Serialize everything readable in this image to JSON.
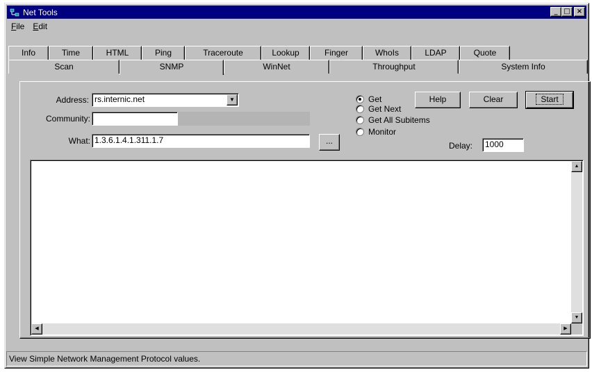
{
  "window": {
    "title": "Net Tools",
    "title_icon": "network-icon",
    "controls": [
      "minimize",
      "maximize",
      "close"
    ]
  },
  "menu": [
    {
      "label": "File",
      "accel": "F",
      "rest": "ile"
    },
    {
      "label": "Edit",
      "accel": "E",
      "rest": "dit"
    }
  ],
  "tabs": {
    "row1": [
      "Info",
      "Time",
      "HTML",
      "Ping",
      "Traceroute",
      "Lookup",
      "Finger",
      "WhoIs",
      "LDAP",
      "Quote"
    ],
    "row2": [
      "Scan",
      "SNMP",
      "WinNet",
      "Throughput",
      "System Info"
    ],
    "active": "SNMP"
  },
  "form": {
    "address_label": "Address:",
    "address_value": "rs.internic.net",
    "community_label": "Community:",
    "community_value": "",
    "what_label": "What:",
    "what_value": "1.3.6.1.4.1.311.1.7",
    "browse_label": "...",
    "delay_label": "Delay:",
    "delay_value": "1000"
  },
  "radios": [
    {
      "label": "Get",
      "checked": true
    },
    {
      "label": "Get Next",
      "checked": false
    },
    {
      "label": "Get All Subitems",
      "checked": false
    },
    {
      "label": "Monitor",
      "checked": false
    }
  ],
  "buttons": {
    "help": "Help",
    "clear": "Clear",
    "start": "Start"
  },
  "output": {
    "text": ""
  },
  "status": "View Simple Network Management Protocol values."
}
